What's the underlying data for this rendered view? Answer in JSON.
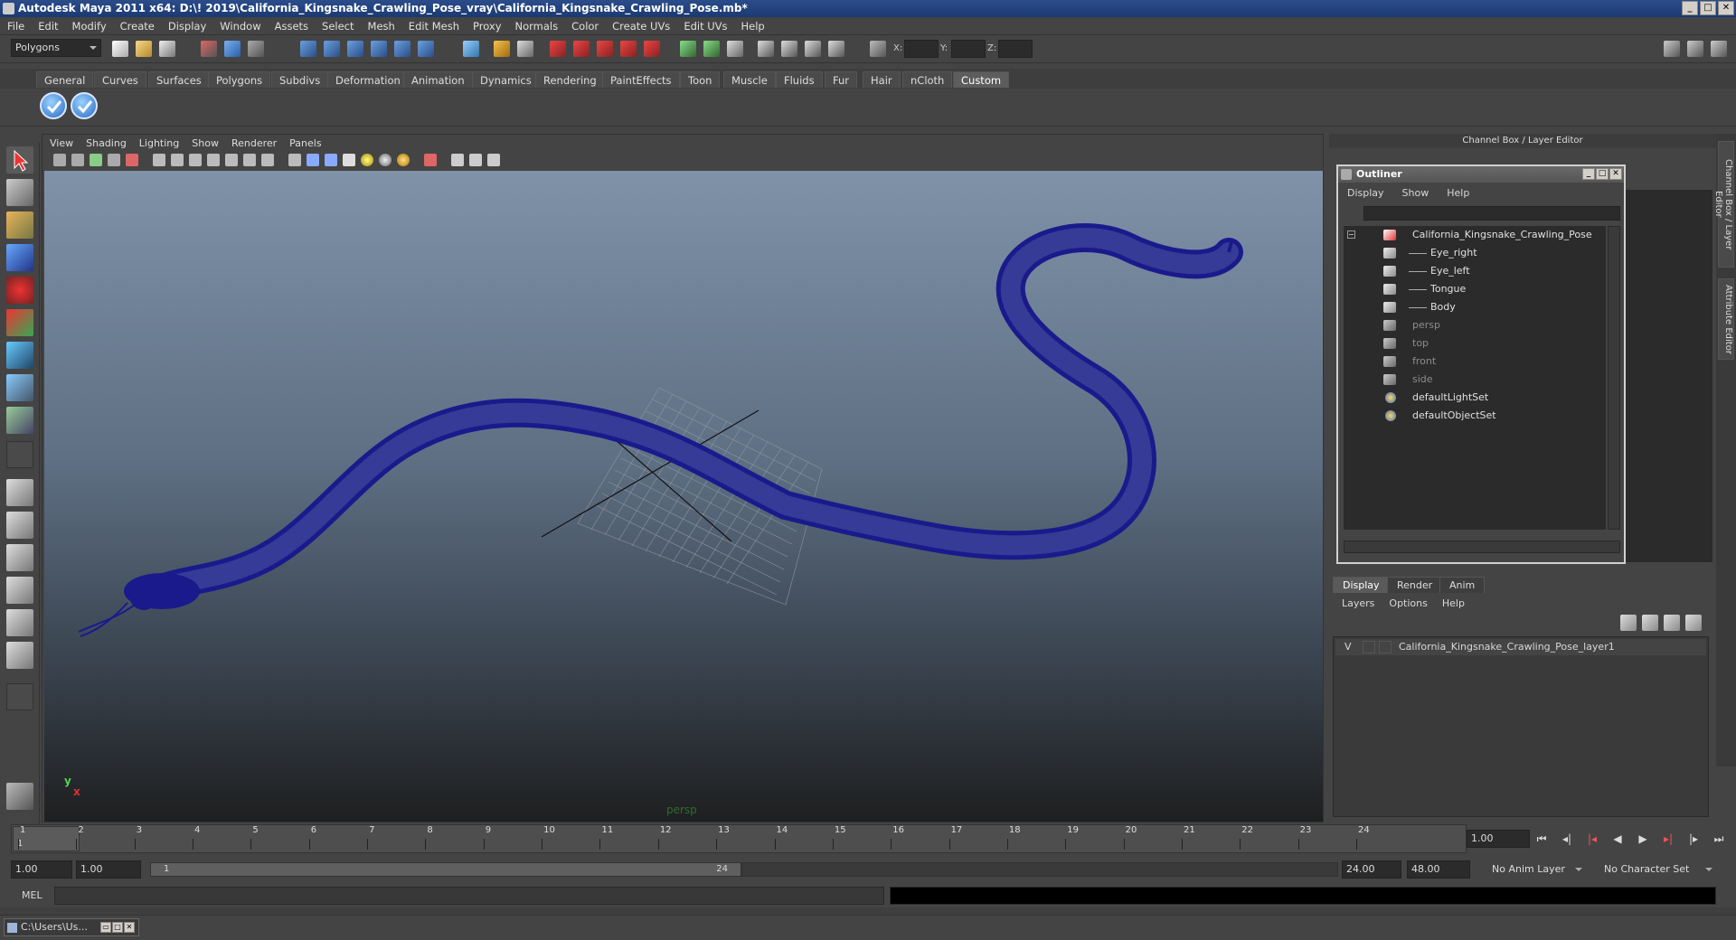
{
  "window": {
    "title": "Autodesk Maya 2011 x64: D:\\! 2019\\California_Kingsnake_Crawling_Pose_vray\\California_Kingsnake_Crawling_Pose.mb*"
  },
  "menubar": [
    "File",
    "Edit",
    "Modify",
    "Create",
    "Display",
    "Window",
    "Assets",
    "Select",
    "Mesh",
    "Edit Mesh",
    "Proxy",
    "Normals",
    "Color",
    "Create UVs",
    "Edit UVs",
    "Help"
  ],
  "statusline": {
    "mode": "Polygons",
    "x_label": "X:",
    "y_label": "Y:",
    "z_label": "Z:"
  },
  "shelf": {
    "tabs": [
      "General",
      "Curves",
      "Surfaces",
      "Polygons",
      "Subdivs",
      "Deformation",
      "Animation",
      "Dynamics",
      "Rendering",
      "PaintEffects",
      "Toon",
      "Muscle",
      "Fluids",
      "Fur",
      "Hair",
      "nCloth",
      "Custom"
    ],
    "active_tab": "Custom"
  },
  "viewport": {
    "menu": [
      "View",
      "Shading",
      "Lighting",
      "Show",
      "Renderer",
      "Panels"
    ],
    "camera_label": "persp",
    "axis_y": "y",
    "axis_x": "x",
    "wire_color": "#1a1a8c"
  },
  "channel_box": {
    "header": "Channel Box / Layer Editor"
  },
  "side_tabs": {
    "channel": "Channel Box / Layer Editor",
    "attribute": "Attribute Editor"
  },
  "outliner": {
    "title": "Outliner",
    "menu": [
      "Display",
      "Show",
      "Help"
    ],
    "items": [
      {
        "label": "California_Kingsnake_Crawling_Pose",
        "dim": false
      },
      {
        "label": "Eye_right",
        "dim": false
      },
      {
        "label": "Eye_left",
        "dim": false
      },
      {
        "label": "Tongue",
        "dim": false
      },
      {
        "label": "Body",
        "dim": false
      },
      {
        "label": "persp",
        "dim": true
      },
      {
        "label": "top",
        "dim": true
      },
      {
        "label": "front",
        "dim": true
      },
      {
        "label": "side",
        "dim": true
      },
      {
        "label": "defaultLightSet",
        "dim": false
      },
      {
        "label": "defaultObjectSet",
        "dim": false
      }
    ]
  },
  "layer_editor": {
    "tabs": [
      "Display",
      "Render",
      "Anim"
    ],
    "active_tab": "Display",
    "menu": [
      "Layers",
      "Options",
      "Help"
    ],
    "layer_visibility": "V",
    "layer_name": "California_Kingsnake_Crawling_Pose_layer1"
  },
  "timeline": {
    "start_frame": "1",
    "ticks": [
      "1",
      "2",
      "3",
      "4",
      "5",
      "6",
      "7",
      "8",
      "9",
      "10",
      "11",
      "12",
      "13",
      "14",
      "15",
      "16",
      "17",
      "18",
      "19",
      "20",
      "21",
      "22",
      "23",
      "24"
    ],
    "current_frame": "1.00"
  },
  "range": {
    "start_time": "1.00",
    "start_range": "1.00",
    "range_bar_start": "1",
    "range_bar_end": "24",
    "end_range": "24.00",
    "end_time": "48.00",
    "anim_layer": "No Anim Layer",
    "character_set": "No Character Set"
  },
  "cmdline": {
    "label": "MEL"
  },
  "taskbar": {
    "item": "C:\\Users\\Us..."
  }
}
